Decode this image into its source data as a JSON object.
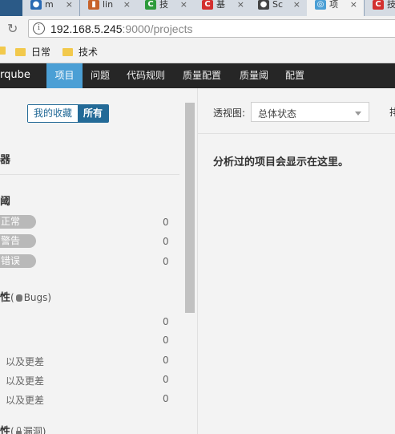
{
  "browser": {
    "tabs": [
      {
        "icon": "blue-paw-favicon-icon",
        "color": "#2a6ab3",
        "glyph": "●",
        "title": "m"
      },
      {
        "icon": "orange-mug-favicon-icon",
        "color": "#c7622a",
        "glyph": "▮",
        "title": "lin"
      },
      {
        "icon": "green-c-favicon-icon",
        "color": "#2e9b3c",
        "glyph": "C",
        "title": "技"
      },
      {
        "icon": "red-c-favicon-icon",
        "color": "#d32f2f",
        "glyph": "C",
        "title": "基"
      },
      {
        "icon": "github-favicon-icon",
        "color": "#444444",
        "glyph": "●",
        "title": "Sc"
      },
      {
        "icon": "sonar-favicon-icon",
        "color": "#4b9fd5",
        "glyph": "◎",
        "title": "项"
      },
      {
        "icon": "red-c-favicon-icon",
        "color": "#d32f2f",
        "glyph": "C",
        "title": "技"
      }
    ],
    "active_tab": 5,
    "url_host": "192.168.5.245",
    "url_rest": ":9000/projects",
    "bookmarks": [
      {
        "label": "日常"
      },
      {
        "label": "技术"
      }
    ]
  },
  "nav": {
    "logo": "rqube",
    "items": [
      {
        "label": "项目",
        "active": true
      },
      {
        "label": "问题"
      },
      {
        "label": "代码规则"
      },
      {
        "label": "质量配置"
      },
      {
        "label": "质量阈"
      },
      {
        "label": "配置"
      }
    ]
  },
  "sidebar": {
    "toggle": {
      "favorites": "我的收藏",
      "all": "所有"
    },
    "section_filter": "器",
    "section_gate": "阈",
    "gate_rows": [
      {
        "label": "正常",
        "count": "0"
      },
      {
        "label": "警告",
        "count": "0"
      },
      {
        "label": "错误",
        "count": "0"
      }
    ],
    "section_reliability": {
      "label": "性",
      "paren_open": "(",
      "sub": "Bugs",
      "paren_close": ")"
    },
    "reliability_rows": [
      {
        "text": "",
        "count": "0"
      },
      {
        "text": "以及更差",
        "count": "0"
      },
      {
        "text": "以及更差",
        "count": "0"
      },
      {
        "text": "以及更差",
        "count": "0"
      },
      {
        "text": "",
        "count": "0"
      }
    ],
    "section_security": {
      "label": "性",
      "paren_open": "(",
      "sub": "漏洞",
      "paren_close": ")"
    }
  },
  "main": {
    "perspective_label": "透视图:",
    "perspective_value": "总体状态",
    "cut_label": "排",
    "empty_message": "分析过的项目会显示在这里。"
  }
}
